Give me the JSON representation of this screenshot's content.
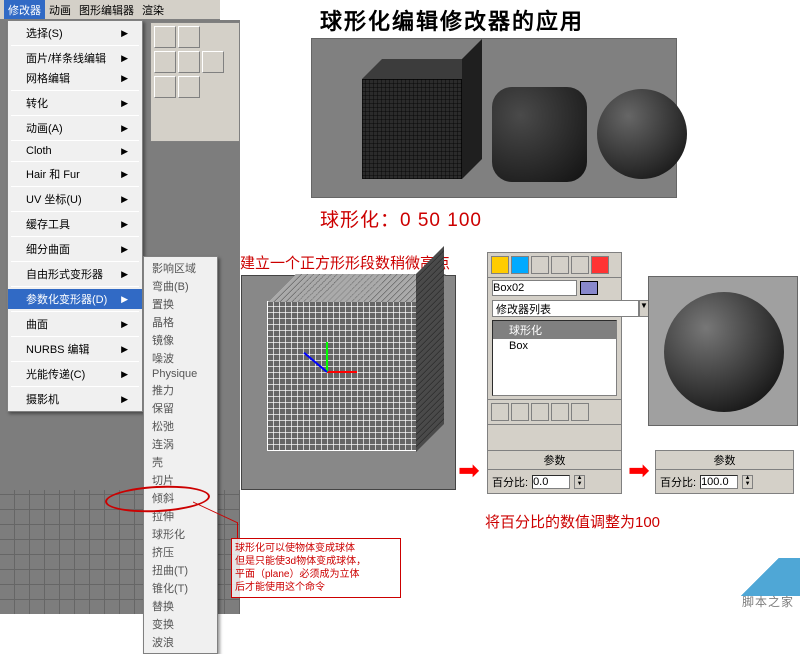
{
  "menubar": {
    "items": [
      "修改器",
      "动画",
      "图形编辑器",
      "渲染"
    ],
    "active": "修改器"
  },
  "dropdown": {
    "items": [
      {
        "label": "选择(S)",
        "arrow": true
      },
      {
        "sep": true
      },
      {
        "label": "面片/样条线编辑",
        "arrow": true
      },
      {
        "label": "网格编辑",
        "arrow": true
      },
      {
        "sep": true
      },
      {
        "label": "转化",
        "arrow": true
      },
      {
        "sep": true
      },
      {
        "label": "动画(A)",
        "arrow": true
      },
      {
        "sep": true
      },
      {
        "label": "Cloth",
        "arrow": true
      },
      {
        "sep": true
      },
      {
        "label": "Hair 和 Fur",
        "arrow": true
      },
      {
        "sep": true
      },
      {
        "label": "UV 坐标(U)",
        "arrow": true
      },
      {
        "sep": true
      },
      {
        "label": "缓存工具",
        "arrow": true
      },
      {
        "sep": true
      },
      {
        "label": "细分曲面",
        "arrow": true
      },
      {
        "sep": true
      },
      {
        "label": "自由形式变形器",
        "arrow": true
      },
      {
        "sep": true
      },
      {
        "label": "参数化变形器(D)",
        "arrow": true,
        "hi": true
      },
      {
        "sep": true
      },
      {
        "label": "曲面",
        "arrow": true
      },
      {
        "sep": true
      },
      {
        "label": "NURBS 编辑",
        "arrow": true
      },
      {
        "sep": true
      },
      {
        "label": "光能传递(C)",
        "arrow": true
      },
      {
        "sep": true
      },
      {
        "label": "摄影机",
        "arrow": true
      }
    ]
  },
  "submenu": {
    "items": [
      "影响区域",
      "弯曲(B)",
      "置换",
      "晶格",
      "镜像",
      "噪波",
      "Physique",
      "推力",
      "保留",
      "松弛",
      "连涡",
      "壳",
      "切片",
      "倾斜",
      "拉伸",
      "球形化",
      "挤压",
      "扭曲(T)",
      "锥化(T)",
      "替换",
      "变换",
      "波浪"
    ]
  },
  "title_top": "球形化编辑修改器的应用",
  "sph_label": "球形化：0  50  100",
  "sub_title": "建立一个正方形形段数稍微高点",
  "command_panel": {
    "obj_name": "Box02",
    "modlist_label": "修改器列表",
    "stack": [
      "球形化",
      "Box"
    ]
  },
  "rollout": {
    "header": "参数",
    "pct_label": "百分比:",
    "val_left": "0.0",
    "val_right": "100.0"
  },
  "bottom_red": "将百分比的数值调整为100",
  "note": {
    "l1": "球形化可以使物体变成球体",
    "l2": "但是只能使3d物体变成球体，",
    "l3": "平面（plane）必须成为立体",
    "l4": "后才能使用这个命令"
  },
  "watermark": "脚本之家"
}
